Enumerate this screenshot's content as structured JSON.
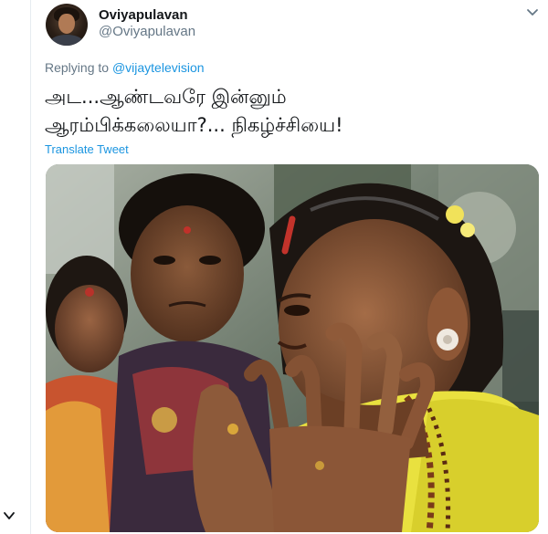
{
  "tweet": {
    "display_name": "Oviyapulavan",
    "handle": "@Oviyapulavan",
    "replying_prefix": "Replying to",
    "replying_mention": "@vijaytelevision",
    "text_line1": "அட...ஆண்டவரே இன்னும்",
    "text_line2": "ஆரம்பிக்கலையா?... நிகழ்ச்சியை!",
    "translate_label": "Translate Tweet"
  },
  "icons": {
    "menu_caret": "chevron-down-icon",
    "left_panel_chevron": "chevron-down-icon"
  },
  "colors": {
    "link_blue": "#1b95e0",
    "secondary_text": "#657786",
    "primary_text": "#14171a",
    "saree_yellow": "#e9e13f"
  }
}
